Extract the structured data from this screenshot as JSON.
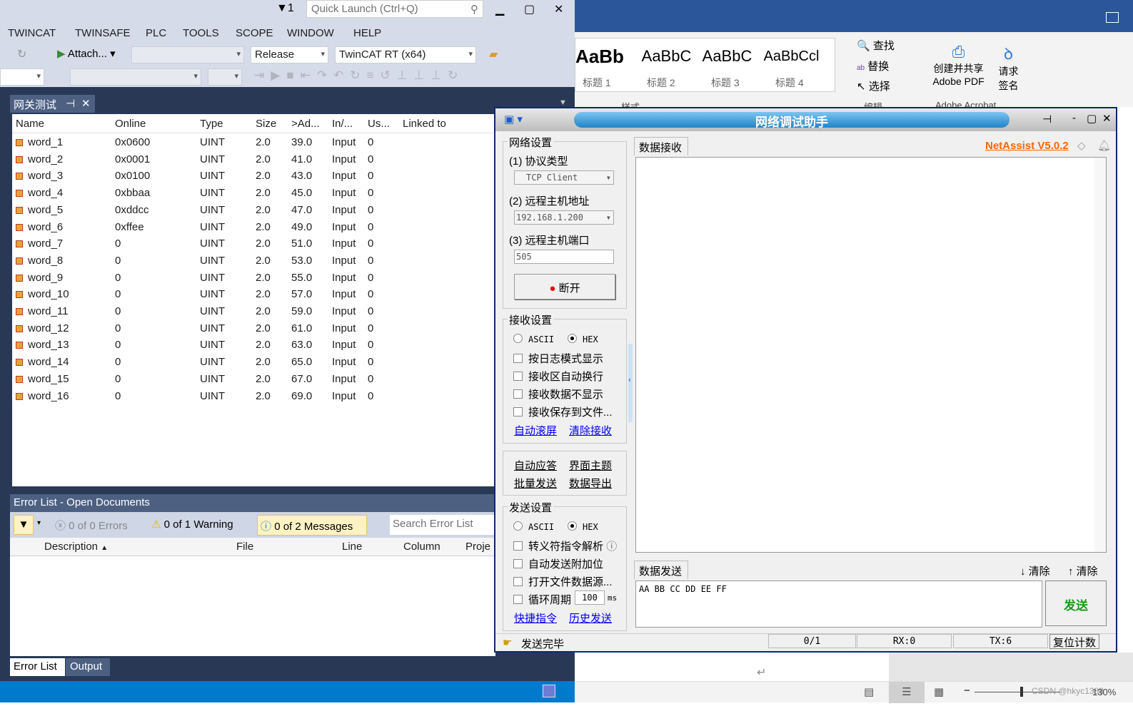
{
  "vs": {
    "filter_count": "1",
    "quick_launch_placeholder": "Quick Launch (Ctrl+Q)",
    "menu": [
      "TWINCAT",
      "TWINSAFE",
      "PLC",
      "TOOLS",
      "SCOPE",
      "WINDOW",
      "HELP"
    ],
    "attach_label": "Attach...",
    "config": "Release",
    "platform": "TwinCAT RT (x64)",
    "doc_tab": "网关测试",
    "columns": [
      "Name",
      "Online",
      "Type",
      "Size",
      ">Ad...",
      "In/...",
      "Us...",
      "Linked to"
    ],
    "rows": [
      [
        "word_1",
        "0x0600",
        "UINT",
        "2.0",
        "39.0",
        "Input",
        "0"
      ],
      [
        "word_2",
        "0x0001",
        "UINT",
        "2.0",
        "41.0",
        "Input",
        "0"
      ],
      [
        "word_3",
        "0x0100",
        "UINT",
        "2.0",
        "43.0",
        "Input",
        "0"
      ],
      [
        "word_4",
        "0xbbaa",
        "UINT",
        "2.0",
        "45.0",
        "Input",
        "0"
      ],
      [
        "word_5",
        "0xddcc",
        "UINT",
        "2.0",
        "47.0",
        "Input",
        "0"
      ],
      [
        "word_6",
        "0xffee",
        "UINT",
        "2.0",
        "49.0",
        "Input",
        "0"
      ],
      [
        "word_7",
        "0",
        "UINT",
        "2.0",
        "51.0",
        "Input",
        "0"
      ],
      [
        "word_8",
        "0",
        "UINT",
        "2.0",
        "53.0",
        "Input",
        "0"
      ],
      [
        "word_9",
        "0",
        "UINT",
        "2.0",
        "55.0",
        "Input",
        "0"
      ],
      [
        "word_10",
        "0",
        "UINT",
        "2.0",
        "57.0",
        "Input",
        "0"
      ],
      [
        "word_11",
        "0",
        "UINT",
        "2.0",
        "59.0",
        "Input",
        "0"
      ],
      [
        "word_12",
        "0",
        "UINT",
        "2.0",
        "61.0",
        "Input",
        "0"
      ],
      [
        "word_13",
        "0",
        "UINT",
        "2.0",
        "63.0",
        "Input",
        "0"
      ],
      [
        "word_14",
        "0",
        "UINT",
        "2.0",
        "65.0",
        "Input",
        "0"
      ],
      [
        "word_15",
        "0",
        "UINT",
        "2.0",
        "67.0",
        "Input",
        "0"
      ],
      [
        "word_16",
        "0",
        "UINT",
        "2.0",
        "69.0",
        "Input",
        "0"
      ]
    ],
    "error_list": {
      "title": "Error List - Open Documents",
      "errors": "0 of 0 Errors",
      "warnings": "0 of 1 Warning",
      "messages": "0 of 2 Messages",
      "search_placeholder": "Search Error List",
      "columns": [
        "Description",
        "File",
        "Line",
        "Column",
        "Proje"
      ]
    },
    "bottom_tabs": [
      "Error List",
      "Output"
    ]
  },
  "word": {
    "styles": [
      {
        "preview": "AaBb",
        "name": "标题 1"
      },
      {
        "preview": "AaBbC",
        "name": "标题 2"
      },
      {
        "preview": "AaBbC",
        "name": "标题 3"
      },
      {
        "preview": "AaBbCcl",
        "name": "标题 4"
      }
    ],
    "find": "查找",
    "replace": "替换",
    "select": "选择",
    "group_styles": "样式",
    "group_edit": "编辑",
    "group_acrobat": "Adobe Acrobat",
    "create_pdf": "创建并共享",
    "create_pdf2": "Adobe PDF",
    "sign": "请求",
    "sign2": "签名",
    "zoom": "130%",
    "watermark": "CSDN @hkyc1388"
  },
  "netassist": {
    "title": "网络调试助手",
    "version": "NetAssist V5.0.2",
    "net_settings": "网络设置",
    "protocol_label": "(1) 协议类型",
    "protocol": "TCP Client",
    "host_label": "(2) 远程主机地址",
    "host": "192.168.1.200",
    "port_label": "(3) 远程主机端口",
    "port": "505",
    "disconnect": "断开",
    "recv_settings": "接收设置",
    "ascii": "ASCII",
    "hex": "HEX",
    "recv_opts": [
      "按日志模式显示",
      "接收区自动换行",
      "接收数据不显示",
      "接收保存到文件..."
    ],
    "auto_scroll": "自动滚屏",
    "clear_recv": "清除接收",
    "tools": [
      "自动应答",
      "界面主题",
      "批量发送",
      "数据导出"
    ],
    "send_settings": "发送设置",
    "send_opts": [
      "转义符指令解析",
      "自动发送附加位",
      "打开文件数据源...",
      "循环周期"
    ],
    "period": "100",
    "period_unit": "ms",
    "quick_cmd": "快捷指令",
    "history": "历史发送",
    "recv_tab": "数据接收",
    "send_tab": "数据发送",
    "clear1": "清除",
    "clear2": "清除",
    "send_text": "AA BB CC DD EE FF",
    "send_btn": "发送",
    "status": "发送完毕",
    "count": "0/1",
    "rx": "RX:0",
    "tx": "TX:6",
    "reset": "复位计数"
  }
}
